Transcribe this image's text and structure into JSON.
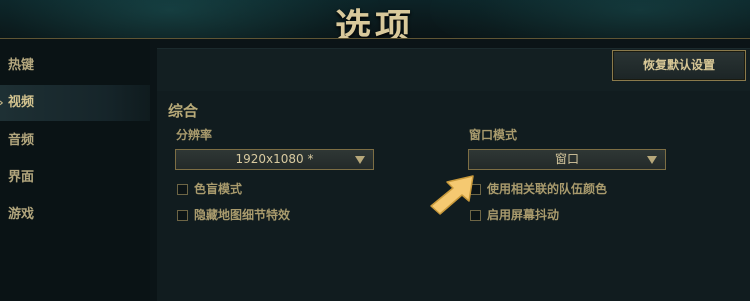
{
  "header": {
    "title": "选项"
  },
  "sidebar": {
    "items": [
      {
        "label": "热键",
        "active": false
      },
      {
        "label": "视频",
        "active": true
      },
      {
        "label": "音频",
        "active": false
      },
      {
        "label": "界面",
        "active": false
      },
      {
        "label": "游戏",
        "active": false
      }
    ]
  },
  "toolbar": {
    "reset_label": "恢复默认设置"
  },
  "section": {
    "title": "综合"
  },
  "resolution": {
    "label": "分辨率",
    "value": "1920x1080 *"
  },
  "window_mode": {
    "label": "窗口模式",
    "value": "窗口"
  },
  "options_left": [
    {
      "label": "色盲模式",
      "checked": false
    },
    {
      "label": "隐藏地图细节特效",
      "checked": false
    }
  ],
  "options_right": [
    {
      "label": "使用相关联的队伍颜色",
      "checked": false
    },
    {
      "label": "启用屏幕抖动",
      "checked": false
    }
  ],
  "colors": {
    "accent": "#c8b98a",
    "pointer": "#f5c971"
  }
}
